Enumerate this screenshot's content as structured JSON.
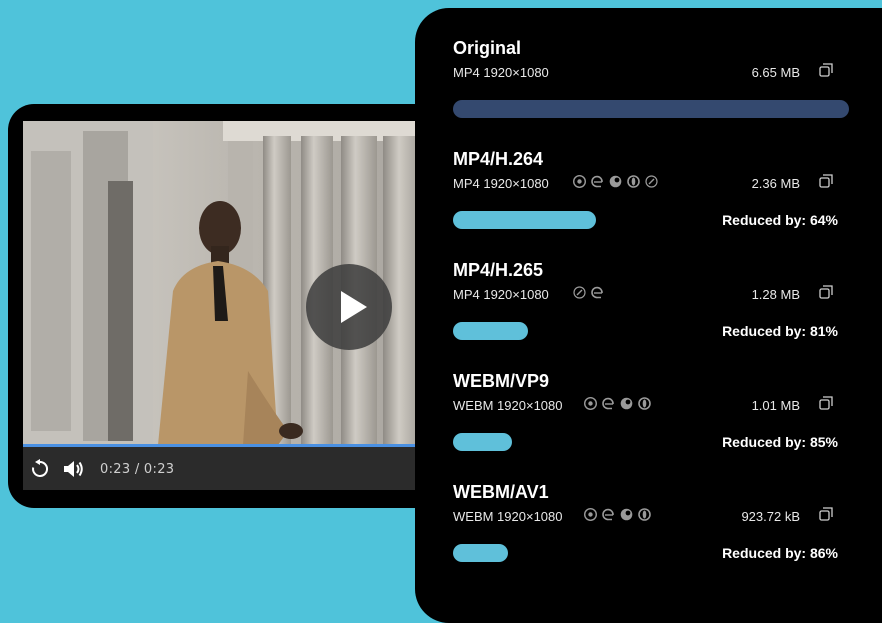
{
  "player": {
    "time": "0:23 / 0:23",
    "progress": 1.0
  },
  "colors": {
    "background": "#4fc3da",
    "original_bar": "#34496f",
    "reduced_bar": "#5fc0da",
    "seek_bar": "#4a90e2"
  },
  "formats": [
    {
      "title": "Original",
      "spec": "MP4 1920×1080",
      "browsers": [],
      "size": "6.65 MB",
      "reduced": "",
      "bar_fraction": 1.0
    },
    {
      "title": "MP4/H.264",
      "spec": "MP4 1920×1080",
      "browsers": [
        "chrome-icon",
        "edge-icon",
        "firefox-icon",
        "opera-icon",
        "safari-icon"
      ],
      "size": "2.36 MB",
      "reduced": "Reduced by: 64%",
      "bar_fraction": 0.36
    },
    {
      "title": "MP4/H.265",
      "spec": "MP4 1920×1080",
      "browsers": [
        "safari-icon",
        "edge-icon"
      ],
      "size": "1.28 MB",
      "reduced": "Reduced by: 81%",
      "bar_fraction": 0.19
    },
    {
      "title": "WEBM/VP9",
      "spec": "WEBM 1920×1080",
      "browsers": [
        "chrome-icon",
        "edge-icon",
        "firefox-icon",
        "opera-icon"
      ],
      "size": "1.01 MB",
      "reduced": "Reduced by: 85%",
      "bar_fraction": 0.15
    },
    {
      "title": "WEBM/AV1",
      "spec": "WEBM 1920×1080",
      "browsers": [
        "chrome-icon",
        "edge-icon",
        "firefox-icon",
        "opera-icon"
      ],
      "size": "923.72 kB",
      "reduced": "Reduced by: 86%",
      "bar_fraction": 0.14
    }
  ]
}
